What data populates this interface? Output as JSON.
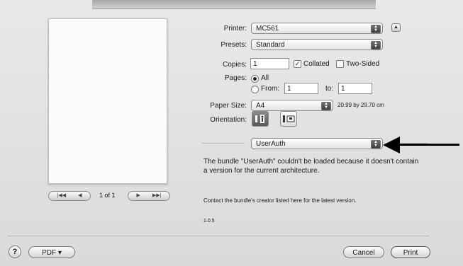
{
  "printer": {
    "label": "Printer:",
    "value": "MC561"
  },
  "presets": {
    "label": "Presets:",
    "value": "Standard"
  },
  "copies": {
    "label": "Copies:",
    "value": "1",
    "collated_label": "Collated",
    "two_sided_label": "Two-Sided"
  },
  "pages": {
    "label": "Pages:",
    "all_label": "All",
    "from_label": "From:",
    "from_value": "1",
    "to_label": "to:",
    "to_value": "1"
  },
  "paper": {
    "label": "Paper Size:",
    "value": "A4",
    "dimensions": "20.99 by 29.70 cm"
  },
  "orientation": {
    "label": "Orientation:"
  },
  "pane": {
    "value": "UserAuth"
  },
  "message": {
    "error": "The bundle \"UserAuth\" couldn't be loaded because it doesn't contain a version for the current architecture.",
    "contact": "Contact the bundle's creator listed here for the latest version.",
    "version": "1.0.5"
  },
  "preview": {
    "page_indicator": "1 of 1"
  },
  "footer": {
    "help_label": "?",
    "pdf_label": "PDF ▾",
    "cancel_label": "Cancel",
    "print_label": "Print"
  }
}
